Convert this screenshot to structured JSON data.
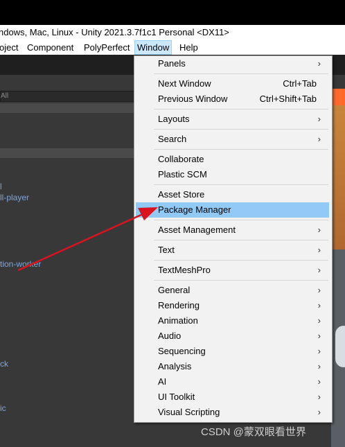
{
  "window_title": "ndows, Mac, Linux - Unity 2021.3.7f1c1 Personal <DX11>",
  "menubar": {
    "items": [
      "oject",
      "Component",
      "PolyPerfect",
      "Window",
      "Help"
    ]
  },
  "left_panel": {
    "search_placeholder": "All",
    "packages": [
      "l",
      "ll-player",
      "tion-worker",
      "ck",
      "ic"
    ]
  },
  "window_menu": {
    "items": [
      {
        "label": "Panels",
        "submenu": true
      },
      {
        "label": "Next Window",
        "shortcut": "Ctrl+Tab"
      },
      {
        "label": "Previous Window",
        "shortcut": "Ctrl+Shift+Tab"
      },
      {
        "label": "Layouts",
        "submenu": true
      },
      {
        "label": "Search",
        "submenu": true
      },
      {
        "label": "Collaborate"
      },
      {
        "label": "Plastic SCM"
      },
      {
        "label": "Asset Store"
      },
      {
        "label": "Package Manager",
        "highlighted": true
      },
      {
        "label": "Asset Management",
        "submenu": true
      },
      {
        "label": "Text",
        "submenu": true
      },
      {
        "label": "TextMeshPro",
        "submenu": true
      },
      {
        "label": "General",
        "submenu": true
      },
      {
        "label": "Rendering",
        "submenu": true
      },
      {
        "label": "Animation",
        "submenu": true
      },
      {
        "label": "Audio",
        "submenu": true
      },
      {
        "label": "Sequencing",
        "submenu": true
      },
      {
        "label": "Analysis",
        "submenu": true
      },
      {
        "label": "AI",
        "submenu": true
      },
      {
        "label": "UI Toolkit",
        "submenu": true
      },
      {
        "label": "Visual Scripting",
        "submenu": true
      }
    ],
    "submenu_icon": "chevron-right-icon"
  },
  "annotation": {
    "color": "#d9131f",
    "icon": "red-arrow-icon"
  },
  "colors": {
    "highlight": "#91c9f7",
    "menu_bg": "#f2f2f2",
    "link": "#7fa6dd"
  },
  "watermark": "CSDN @蒙双眼看世界"
}
